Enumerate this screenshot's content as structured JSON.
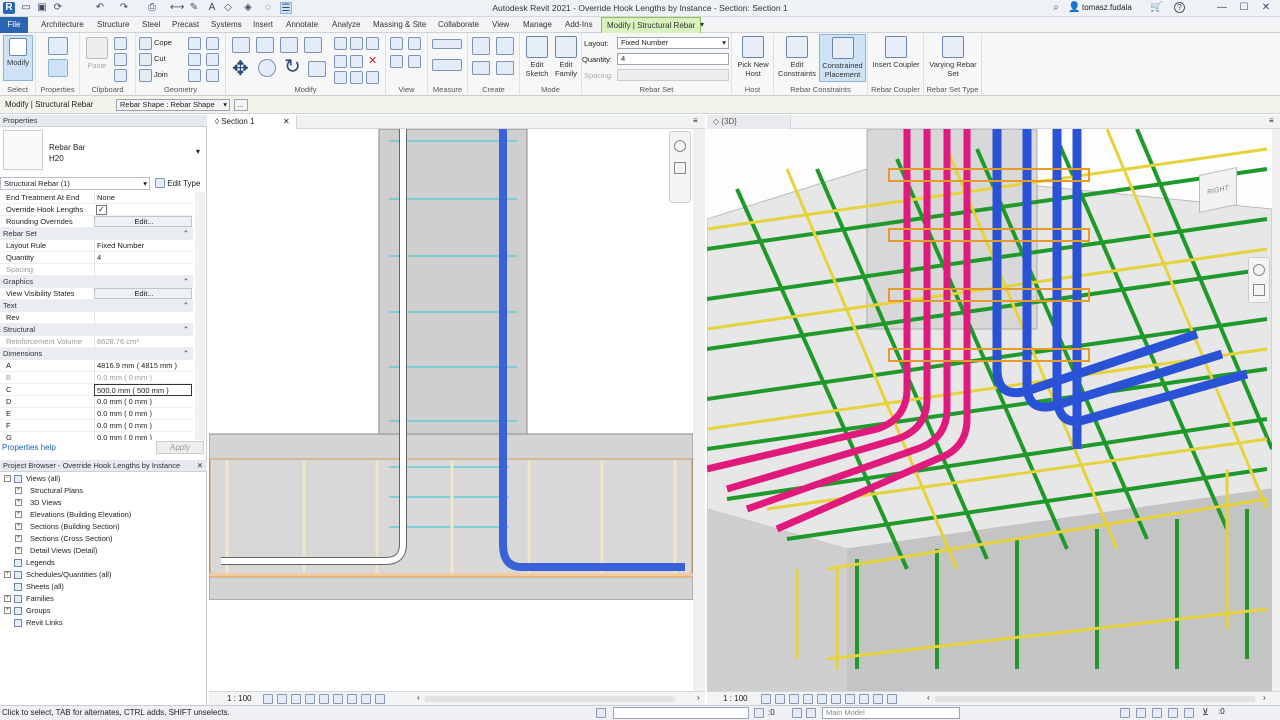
{
  "window": {
    "title": "Autodesk Revit 2021 - Override Hook Lengths by Instance - Section: Section 1",
    "user": "tomasz.fudala",
    "help": "?"
  },
  "ribbon_tabs": [
    "File",
    "Architecture",
    "Structure",
    "Steel",
    "Precast",
    "Systems",
    "Insert",
    "Annotate",
    "Analyze",
    "Massing & Site",
    "Collaborate",
    "View",
    "Manage",
    "Add-Ins",
    "Modify | Structural Rebar"
  ],
  "ribbon": {
    "select": {
      "modify": "Modify",
      "label": "Select"
    },
    "properties": {
      "label": "Properties"
    },
    "clipboard": {
      "paste": "Paste",
      "label": "Clipboard"
    },
    "geometry": {
      "cope": "Cope",
      "cut": "Cut",
      "join": "Join",
      "label": "Geometry"
    },
    "modify": {
      "label": "Modify"
    },
    "view": {
      "label": "View"
    },
    "measure": {
      "label": "Measure"
    },
    "create": {
      "label": "Create"
    },
    "mode": {
      "edit_sketch": "Edit Sketch",
      "edit_family": "Edit Family",
      "label": "Mode"
    },
    "rebar_set": {
      "layout_label": "Layout:",
      "layout_value": "Fixed Number",
      "quantity_label": "Quantity:",
      "quantity_value": "4",
      "spacing_label": "Spacing:",
      "label": "Rebar Set"
    },
    "host": {
      "pick_new_host": "Pick New Host",
      "label": "Host"
    },
    "rebar_constraints": {
      "edit_constraints": "Edit Constraints",
      "constrained_placement": "Constrained Placement",
      "label": "Rebar Constraints"
    },
    "rebar_coupler": {
      "insert_coupler": "Insert Coupler",
      "label": "Rebar Coupler"
    },
    "rebar_set_type": {
      "varying": "Varying Rebar Set",
      "label": "Rebar Set Type"
    }
  },
  "options_bar": {
    "context": "Modify | Structural Rebar",
    "shape_select": "Rebar Shape : Rebar Shape",
    "more": "..."
  },
  "properties": {
    "header": "Properties",
    "type_name": "Rebar Bar",
    "type_sub": "H20",
    "instance_filter": "Structural Rebar (1)",
    "edit_type": "Edit Type",
    "rows": [
      {
        "type": "row",
        "key": "End Treatment At End",
        "value": "None"
      },
      {
        "type": "check",
        "key": "Override Hook Lengths",
        "value": "✓"
      },
      {
        "type": "button",
        "key": "Rounding Overrides",
        "value": "Edit..."
      },
      {
        "type": "cat",
        "key": "Rebar Set"
      },
      {
        "type": "row",
        "key": "Layout Rule",
        "value": "Fixed Number"
      },
      {
        "type": "row",
        "key": "Quantity",
        "value": "4"
      },
      {
        "type": "grey",
        "key": "Spacing",
        "value": ""
      },
      {
        "type": "cat",
        "key": "Graphics"
      },
      {
        "type": "button",
        "key": "View Visibility States",
        "value": "Edit..."
      },
      {
        "type": "cat",
        "key": "Text"
      },
      {
        "type": "row",
        "key": "Rev",
        "value": ""
      },
      {
        "type": "cat",
        "key": "Structural"
      },
      {
        "type": "grey",
        "key": "Reinforcement Volume",
        "value": "6628.76 cm³"
      },
      {
        "type": "cat",
        "key": "Dimensions"
      },
      {
        "type": "row",
        "key": "A",
        "value": "4816.9 mm ( 4815 mm )"
      },
      {
        "type": "grey",
        "key": "B",
        "value": "0.0 mm ( 0 mm )"
      },
      {
        "type": "edit",
        "key": "C",
        "value": "500.0 mm ( 500 mm )"
      },
      {
        "type": "row",
        "key": "D",
        "value": "0.0 mm ( 0 mm )"
      },
      {
        "type": "row",
        "key": "E",
        "value": "0.0 mm ( 0 mm )"
      },
      {
        "type": "row",
        "key": "F",
        "value": "0.0 mm ( 0 mm )"
      },
      {
        "type": "row",
        "key": "G",
        "value": "0.0 mm ( 0 mm )"
      }
    ],
    "help_link": "Properties help",
    "apply": "Apply"
  },
  "project_browser": {
    "header": "Project Browser - Override Hook Lengths by Instance",
    "items": [
      {
        "label": "Views (all)",
        "indent": 1,
        "expander": "−"
      },
      {
        "label": "Structural Plans",
        "indent": 2,
        "expander": "+"
      },
      {
        "label": "3D Views",
        "indent": 2,
        "expander": "+"
      },
      {
        "label": "Elevations (Building Elevation)",
        "indent": 2,
        "expander": "+"
      },
      {
        "label": "Sections (Building Section)",
        "indent": 2,
        "expander": "+"
      },
      {
        "label": "Sections (Cross Section)",
        "indent": 2,
        "expander": "+"
      },
      {
        "label": "Detail Views (Detail)",
        "indent": 2,
        "expander": "+"
      },
      {
        "label": "Legends",
        "indent": 1,
        "expander": ""
      },
      {
        "label": "Schedules/Quantities (all)",
        "indent": 1,
        "expander": "+"
      },
      {
        "label": "Sheets (all)",
        "indent": 1,
        "expander": ""
      },
      {
        "label": "Families",
        "indent": 1,
        "expander": "+"
      },
      {
        "label": "Groups",
        "indent": 1,
        "expander": "+"
      },
      {
        "label": "Revit Links",
        "indent": 1,
        "expander": ""
      }
    ]
  },
  "views": {
    "section_tab": "Section 1",
    "view3d_tab": "{3D}",
    "scale": "1 : 100",
    "viewcube": "RIGHT"
  },
  "status": {
    "hint": "Click to select, TAB for alternates, CTRL adds, SHIFT unselects.",
    "zero": ":0",
    "model": "Main Model"
  },
  "colors": {
    "accent": "#2a66b0",
    "context_tab": "#d9f2bf",
    "rebar_green": "#1f9a2a",
    "rebar_yellow": "#e6d33a",
    "rebar_magenta": "#e0197d",
    "rebar_blue": "#2a52d6",
    "rebar_orange": "#e59a2a"
  }
}
